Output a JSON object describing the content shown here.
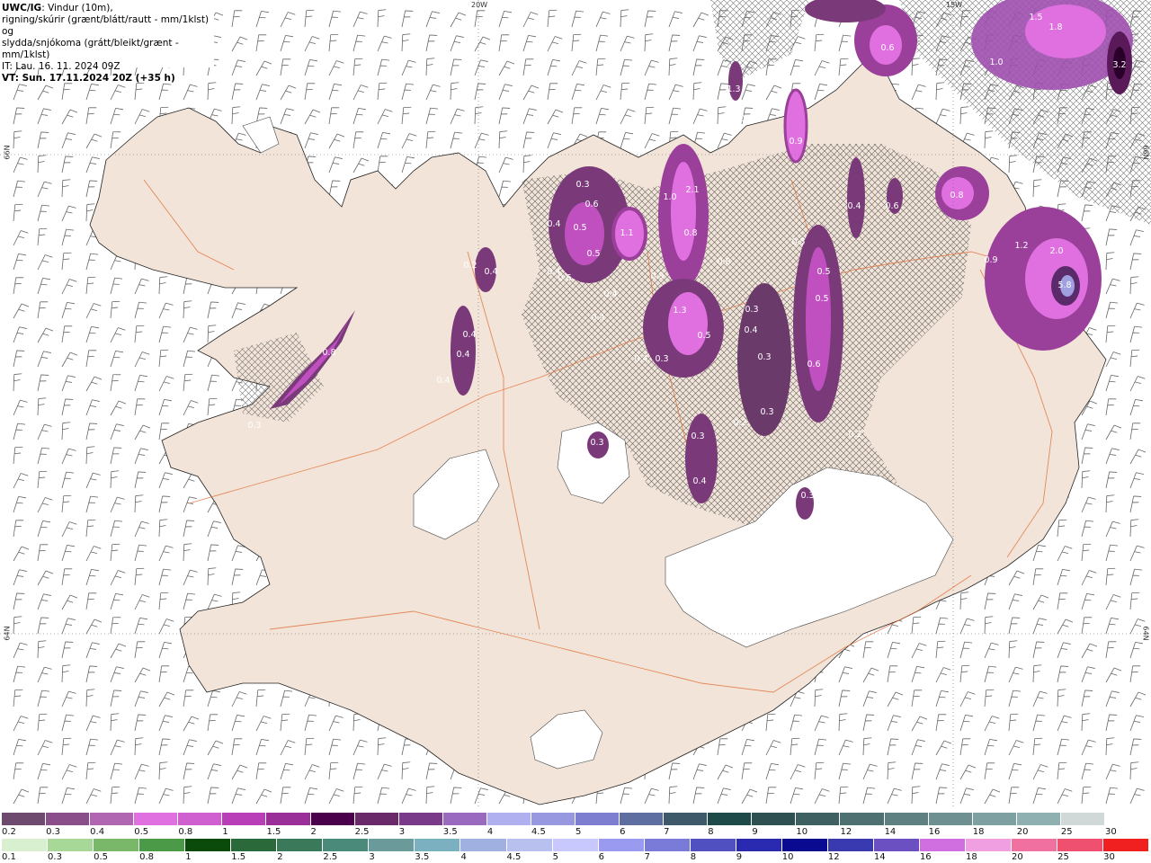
{
  "header": {
    "line1_prefix": "UWC/IG",
    "line1_rest": ": Vindur (10m),",
    "line2": "rigning/skúrir (grænt/blátt/rautt - mm/1klst) og",
    "line3": "slydda/snjókoma (grátt/bleikt/grænt - mm/1klst)",
    "line4": "IT: Lau. 16. 11. 2024 09Z",
    "line5": "VT: Sun. 17.11.2024 20Z (+35 h)"
  },
  "axis_labels": {
    "lon_20w": "20W",
    "lon_15w": "15W",
    "lat_66n_left": "66N",
    "lat_64n_left": "64N",
    "lat_66n_right": "66N",
    "lat_64n_right": "64N"
  },
  "precip_values": [
    {
      "v": "1.5"
    },
    {
      "v": "1.8"
    },
    {
      "v": "3.2"
    },
    {
      "v": "1.0"
    },
    {
      "v": "0.6"
    },
    {
      "v": "1.3"
    },
    {
      "v": "0.3"
    },
    {
      "v": "0.9"
    },
    {
      "v": "0.3"
    },
    {
      "v": "0.6"
    },
    {
      "v": "0.4"
    },
    {
      "v": "0.5"
    },
    {
      "v": "1.1"
    },
    {
      "v": "1.0"
    },
    {
      "v": "2.1"
    },
    {
      "v": "0.8"
    },
    {
      "v": "0.9"
    },
    {
      "v": "0.5"
    },
    {
      "v": "0.4"
    },
    {
      "v": "0.4"
    },
    {
      "v": "0.8"
    },
    {
      "v": "0.4"
    },
    {
      "v": "1.2"
    },
    {
      "v": "2.0"
    },
    {
      "v": "0.9"
    },
    {
      "v": "5.8"
    },
    {
      "v": "0.8"
    },
    {
      "v": "0.4"
    },
    {
      "v": "0.6"
    },
    {
      "v": "0.5"
    },
    {
      "v": "0.5"
    },
    {
      "v": "0.5"
    },
    {
      "v": "0.3"
    },
    {
      "v": "0.4"
    },
    {
      "v": "0.3"
    },
    {
      "v": "0.6"
    },
    {
      "v": "1.3"
    },
    {
      "v": "0.5"
    },
    {
      "v": "0.4"
    },
    {
      "v": "0.3"
    },
    {
      "v": "0.2"
    },
    {
      "v": "0.3"
    },
    {
      "v": "0.3"
    },
    {
      "v": "0.4"
    },
    {
      "v": "0.3"
    },
    {
      "v": "0.2"
    },
    {
      "v": "0.3"
    },
    {
      "v": "0.4"
    },
    {
      "v": "0.4"
    },
    {
      "v": "0.4"
    },
    {
      "v": "0.8"
    },
    {
      "v": "0.3"
    },
    {
      "v": "0.2"
    },
    {
      "v": "0.4"
    },
    {
      "v": "0.6"
    }
  ],
  "legend_snow": {
    "labels": [
      "0.2",
      "0.3",
      "0.4",
      "0.5",
      "0.8",
      "1",
      "1.5",
      "2",
      "2.5",
      "3",
      "3.5",
      "4",
      "4.5",
      "5",
      "6",
      "7",
      "8",
      "9",
      "10",
      "12",
      "14",
      "16",
      "18",
      "20",
      "25",
      "30"
    ],
    "colors": [
      "#6e4a6e",
      "#8a4f8a",
      "#b066b0",
      "#e070e0",
      "#d060d0",
      "#b83fb8",
      "#9a2f9a",
      "#4a004a",
      "#6a2a6a",
      "#7a3a8a",
      "#9a6ac0",
      "#b0b0f0",
      "#9898e0",
      "#7e7ed0",
      "#5e6ea0",
      "#3e5a6a",
      "#1e4a4a",
      "#2e5050",
      "#3e6060",
      "#4e7070",
      "#5e8080",
      "#6e9090",
      "#7ea0a0",
      "#8eb0b0",
      "#d0d8d8",
      "#ffffff"
    ]
  },
  "legend_rain": {
    "labels": [
      "0.1",
      "0.3",
      "0.5",
      "0.8",
      "1",
      "1.5",
      "2",
      "2.5",
      "3",
      "3.5",
      "4",
      "4.5",
      "5",
      "6",
      "7",
      "8",
      "9",
      "10",
      "12",
      "14",
      "16",
      "18",
      "20",
      "25",
      "30"
    ],
    "colors": [
      "#d8f0d0",
      "#a8d898",
      "#78b868",
      "#4a9a48",
      "#0a4a0a",
      "#2a6a3a",
      "#3a7a5a",
      "#4a8a7a",
      "#6a9a9a",
      "#7ab0c0",
      "#a0b0e0",
      "#b8c0f0",
      "#c8c8ff",
      "#9a9af0",
      "#7a7ad8",
      "#5050c0",
      "#2a2ab0",
      "#0a0a90",
      "#3a3ab0",
      "#6a50c0",
      "#d070e0",
      "#f0a0e0",
      "#f070a0",
      "#f05070",
      "#f02020"
    ]
  }
}
